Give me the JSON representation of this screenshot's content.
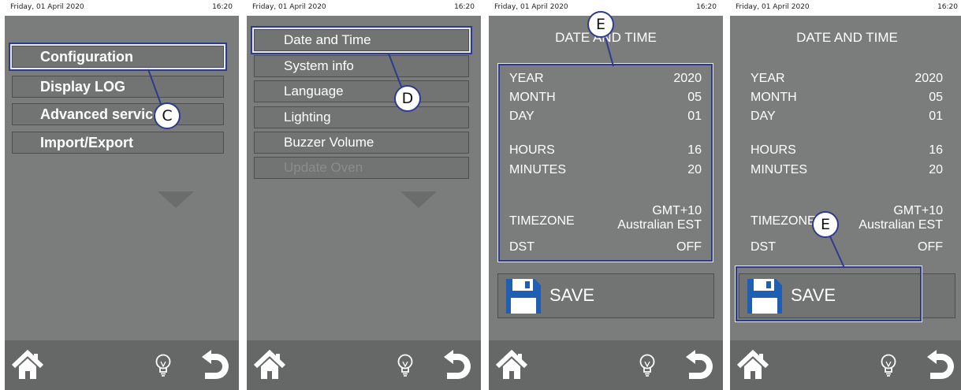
{
  "status": {
    "date": "Friday, 01 April 2020",
    "time": "16:20"
  },
  "panel1": {
    "menu": [
      "Configuration",
      "Display LOG",
      "Advanced services",
      "Import/Export"
    ],
    "callout": "C"
  },
  "panel2": {
    "menu": [
      "Date and Time",
      "System info",
      "Language",
      "Lighting",
      "Buzzer Volume",
      "Update Oven"
    ],
    "callout": "D"
  },
  "datetime": {
    "title": "DATE AND TIME",
    "year_label": "YEAR",
    "year": "2020",
    "month_label": "MONTH",
    "month": "05",
    "day_label": "DAY",
    "day": "01",
    "hours_label": "HOURS",
    "hours": "16",
    "minutes_label": "MINUTES",
    "minutes": "20",
    "timezone_label": "TIMEZONE",
    "timezone_line1": "GMT+10",
    "timezone_line2": "Australian EST",
    "dst_label": "DST",
    "dst": "OFF",
    "save_label": "SAVE"
  },
  "panel3": {
    "callout": "E"
  },
  "panel4": {
    "callout": "E"
  },
  "icons": {
    "home": "home-icon",
    "bulb": "lightbulb-icon",
    "back": "back-arrow-icon",
    "save": "floppy-disk-icon",
    "more": "chevron-down-icon"
  },
  "colors": {
    "panel": "#7b7d7d",
    "bottom_bar": "#666868",
    "button": "#727474",
    "highlight": "#2d3b8e",
    "disk": "#1e5fb4"
  }
}
